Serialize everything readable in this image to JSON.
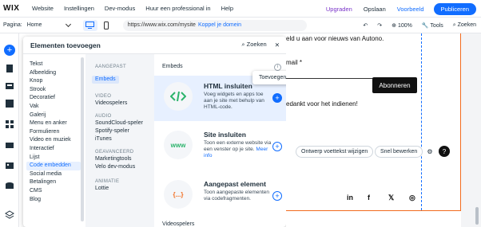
{
  "topbar": {
    "logo": "WIX",
    "menu": [
      "Website",
      "Instellingen",
      "Dev-modus",
      "Huur een professional in",
      "Help"
    ],
    "upgrade": "Upgraden",
    "save": "Opslaan",
    "preview": "Voorbeeld",
    "publish": "Publiceren"
  },
  "toolbar": {
    "page_label": "Pagina:",
    "page_value": "Home",
    "url": "https://www.wix.com/mysite",
    "connect_domain": "Koppel je domein",
    "zoom": "100%",
    "tools": "Tools",
    "search": "Zoeken"
  },
  "panel": {
    "title": "Elementen toevoegen",
    "search": "Zoeken",
    "categories": [
      "Tekst",
      "Afbeelding",
      "Knop",
      "Strook",
      "Decoratief",
      "Vak",
      "Galerij",
      "Menu en anker",
      "Formulieren",
      "Video en muziek",
      "Interactief",
      "Lijst",
      "Code embedden",
      "Social media",
      "Betalingen",
      "CMS",
      "Blog"
    ],
    "active_category": "Code embedden",
    "subgroups": [
      {
        "heading": "AANGEPAST",
        "items": [
          "Embeds"
        ]
      },
      {
        "heading": "VIDEO",
        "items": [
          "Videospelers"
        ]
      },
      {
        "heading": "AUDIO",
        "items": [
          "SoundCloud-speler",
          "Spotify-speler",
          "iTunes"
        ]
      },
      {
        "heading": "GEAVANCEERD",
        "items": [
          "Marketingtools",
          "Velo dev-modus"
        ]
      },
      {
        "heading": "ANIMATIE",
        "items": [
          "Lottie"
        ]
      }
    ],
    "section_title": "Embeds",
    "cards": [
      {
        "title": "HTML insluiten",
        "desc": "Voeg widgets en apps toe aan je site met behulp van HTML-code.",
        "icon": "code-brackets-icon"
      },
      {
        "title": "Site insluiten",
        "desc": "Toon een externe website via een venster op je site.",
        "more": "Meer info",
        "icon": "www-icon"
      },
      {
        "title": "Aangepast element",
        "desc": "Toon aangepaste elementen via codefragmenten.",
        "icon": "curly-braces-icon"
      }
    ],
    "footer_section": "Videospelers",
    "tooltip": "Toevoegen"
  },
  "site": {
    "line1": "eld u aan voor nieuws van Autono.",
    "email_label": "mail *",
    "subscribe": "Abonneren",
    "thanks": "edankt voor het indienen!",
    "edit_footer": "Ontwerp voettekst wijzigen",
    "quick_edit": "Snel bewerken",
    "social": [
      "in",
      "f",
      "𝕏",
      "◎"
    ]
  },
  "colors": {
    "accent": "#116dff",
    "upgrade": "#7a34c9",
    "site_border": "#f26b1d"
  }
}
